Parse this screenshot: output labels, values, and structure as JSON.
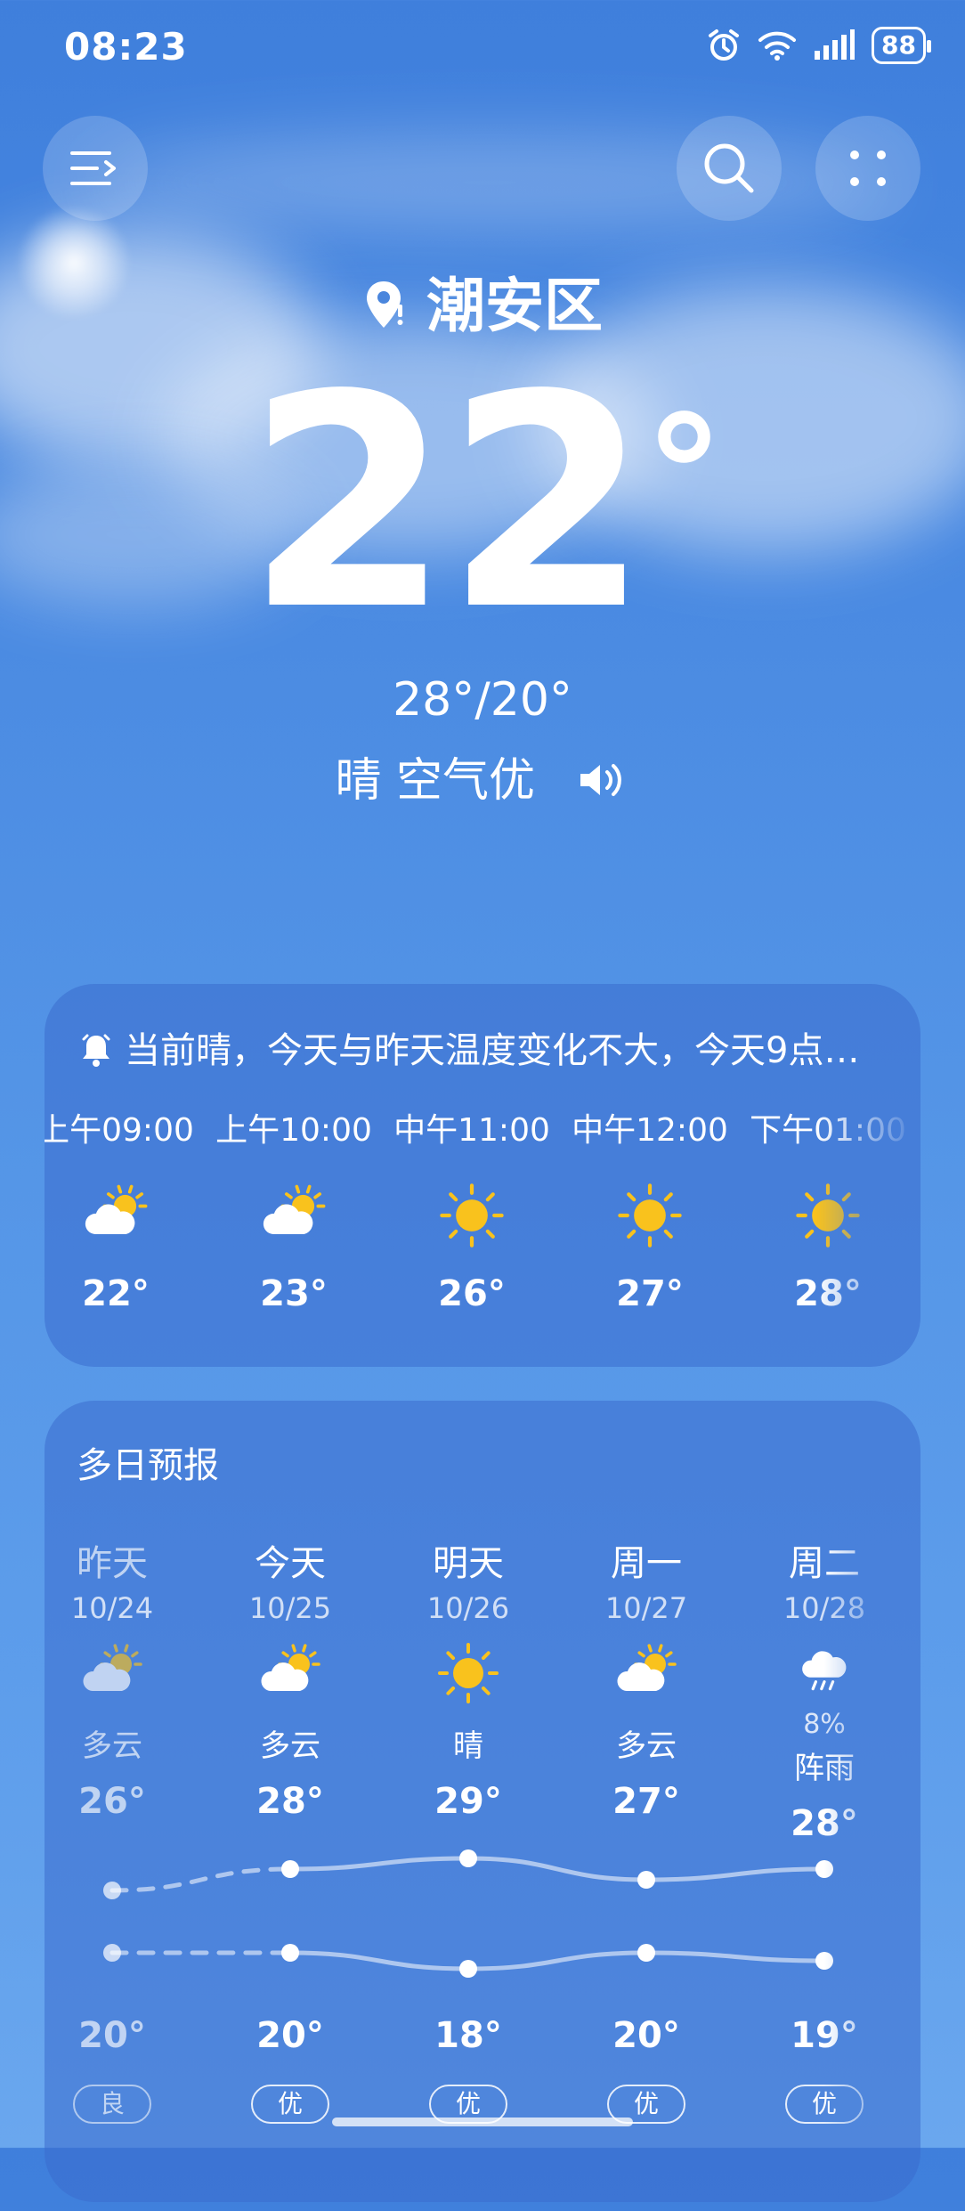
{
  "status_bar": {
    "time": "08:23",
    "battery": "88"
  },
  "location": {
    "city": "潮安区"
  },
  "current": {
    "temp": "22",
    "degree_symbol": "°",
    "range": "28°/20°",
    "condition": "晴 空气优"
  },
  "hourly_card": {
    "alert_text": "当前晴，今天与昨天温度变化不大，今天9点…",
    "hours": [
      {
        "label": "上午09:00",
        "icon": "sun-cloud-icon",
        "temp": "22°"
      },
      {
        "label": "上午10:00",
        "icon": "sun-cloud-icon",
        "temp": "23°"
      },
      {
        "label": "中午11:00",
        "icon": "sun-icon",
        "temp": "26°"
      },
      {
        "label": "中午12:00",
        "icon": "sun-icon",
        "temp": "27°"
      },
      {
        "label": "下午01:00",
        "icon": "sun-icon",
        "temp": "28°"
      }
    ]
  },
  "daily_card": {
    "title": "多日预报",
    "days": [
      {
        "name": "昨天",
        "date": "10/24",
        "icon": "sun-cloud-icon",
        "rain": "",
        "desc": "多云",
        "high": "26°",
        "low": "20°",
        "aq": "良",
        "dim": true
      },
      {
        "name": "今天",
        "date": "10/25",
        "icon": "sun-cloud-icon",
        "rain": "",
        "desc": "多云",
        "high": "28°",
        "low": "20°",
        "aq": "优",
        "dim": false
      },
      {
        "name": "明天",
        "date": "10/26",
        "icon": "sun-icon",
        "rain": "",
        "desc": "晴",
        "high": "29°",
        "low": "18°",
        "aq": "优",
        "dim": false
      },
      {
        "name": "周一",
        "date": "10/27",
        "icon": "sun-cloud-icon",
        "rain": "",
        "desc": "多云",
        "high": "27°",
        "low": "20°",
        "aq": "优",
        "dim": false
      },
      {
        "name": "周二",
        "date": "10/28",
        "icon": "rain-icon",
        "rain": "8%",
        "desc": "阵雨",
        "high": "28°",
        "low": "19°",
        "aq": "优",
        "dim": false
      }
    ]
  },
  "colors": {
    "sun": "#f9c21d",
    "card": "#3a6ccd"
  }
}
